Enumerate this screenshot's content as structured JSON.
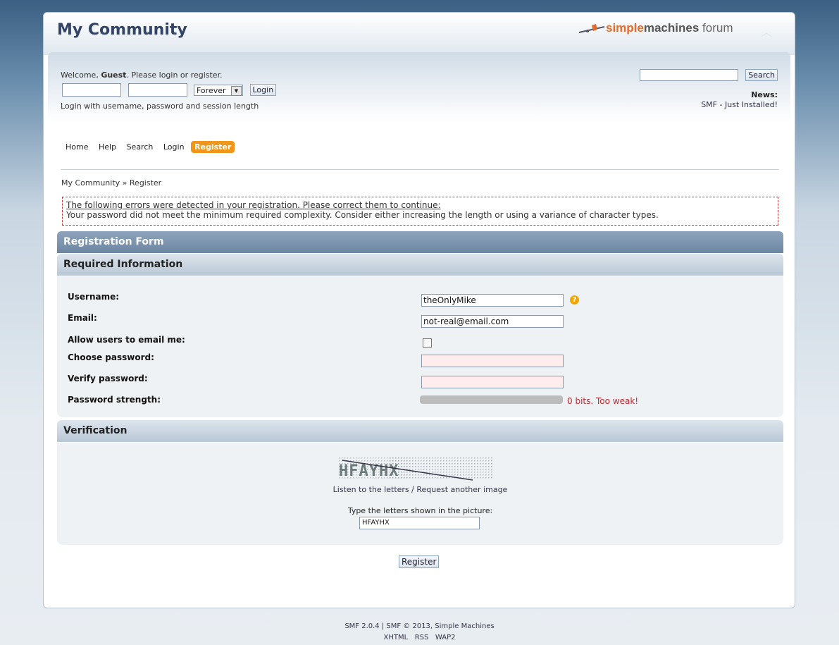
{
  "site": {
    "title": "My Community",
    "logo": {
      "simple": "simple",
      "machines": "machines",
      "forum": " forum"
    }
  },
  "user_area": {
    "welcome_prefix": "Welcome, ",
    "welcome_guest": "Guest",
    "welcome_suffix": ". Please login or register.",
    "username_value": "",
    "password_value": "",
    "session_length": "Forever",
    "login_button": "Login",
    "hint": "Login with username, password and session length"
  },
  "search": {
    "button": "Search",
    "value": ""
  },
  "news": {
    "label": "News:",
    "text": "SMF - Just Installed!"
  },
  "menu": {
    "items": [
      "Home",
      "Help",
      "Search",
      "Login"
    ],
    "active": "Register"
  },
  "breadcrumb": {
    "root": "My Community",
    "separator": " » ",
    "current": "Register"
  },
  "errors": {
    "title": "The following errors were detected in your registration. Please correct them to continue:",
    "message": "Your password did not meet the minimum required complexity. Consider either increasing the length or using a variance of character types."
  },
  "form": {
    "header": "Registration Form",
    "section_required": "Required Information",
    "fields": {
      "username_label": "Username:",
      "username_value": "theOnlyMike",
      "email_label": "Email:",
      "email_value": "not-real@email.com",
      "allow_email_label": "Allow users to email me:",
      "allow_email_checked": false,
      "choose_password_label": "Choose password:",
      "verify_password_label": "Verify password:",
      "strength_label": "Password strength:",
      "strength_text": "0 bits. Too weak!",
      "strength_level": 0
    },
    "help_icon": "?",
    "section_verification": "Verification",
    "captcha": {
      "image_text": "HFAYHX",
      "listen_link": "Listen to the letters",
      "separator": " / ",
      "request_link": "Request another image",
      "prompt": "Type the letters shown in the picture:",
      "input_value": "HFAYHX"
    },
    "submit": "Register"
  },
  "footer": {
    "line1": "SMF 2.0.4 | SMF © 2013, Simple Machines",
    "links": [
      "XHTML",
      "RSS",
      "WAP2"
    ]
  },
  "colors": {
    "accent": "#f0961a",
    "error": "#c0272d",
    "header_dark": "#6c86a2"
  }
}
